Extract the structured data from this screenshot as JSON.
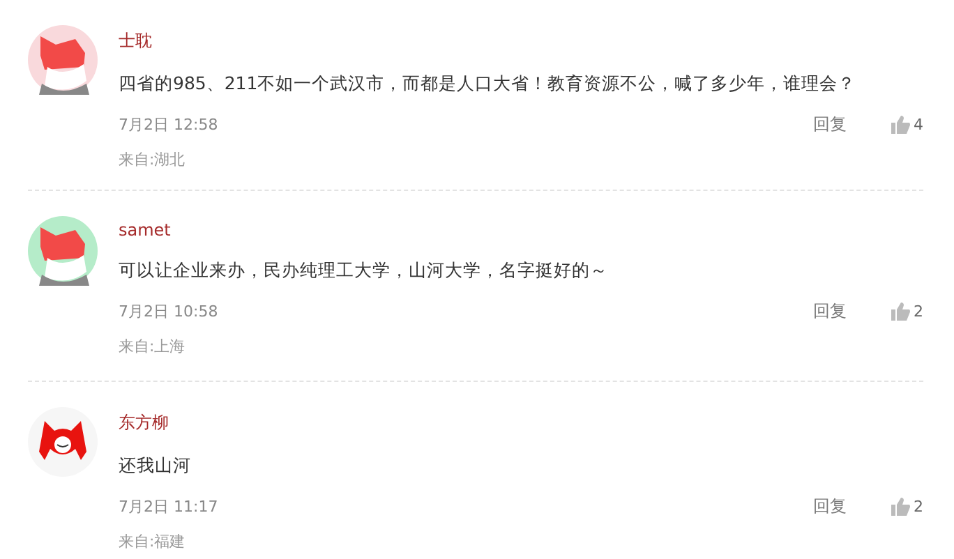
{
  "comments": [
    {
      "user": "士耽",
      "avatar": {
        "kind": "fox",
        "color": "#f9d9dc"
      },
      "text": "四省的985、211不如一个武汉市，而都是人口大省！教育资源不公，喊了多少年，谁理会？",
      "time": "7月2日 12:58",
      "reply": "回复",
      "likes": "4",
      "location": "来自:湖北"
    },
    {
      "user": "samet",
      "avatar": {
        "kind": "fox",
        "color": "#b5ecc9"
      },
      "text": "可以让企业来办，民办纯理工大学，山河大学，名字挺好的～",
      "time": "7月2日 10:58",
      "reply": "回复",
      "likes": "2",
      "location": "来自:上海"
    },
    {
      "user": "东方柳",
      "avatar": {
        "kind": "cartoon",
        "color": "#f6f6f6"
      },
      "text": "还我山河",
      "time": "7月2日 11:17",
      "reply": "回复",
      "likes": "2",
      "location": "来自:福建"
    }
  ]
}
